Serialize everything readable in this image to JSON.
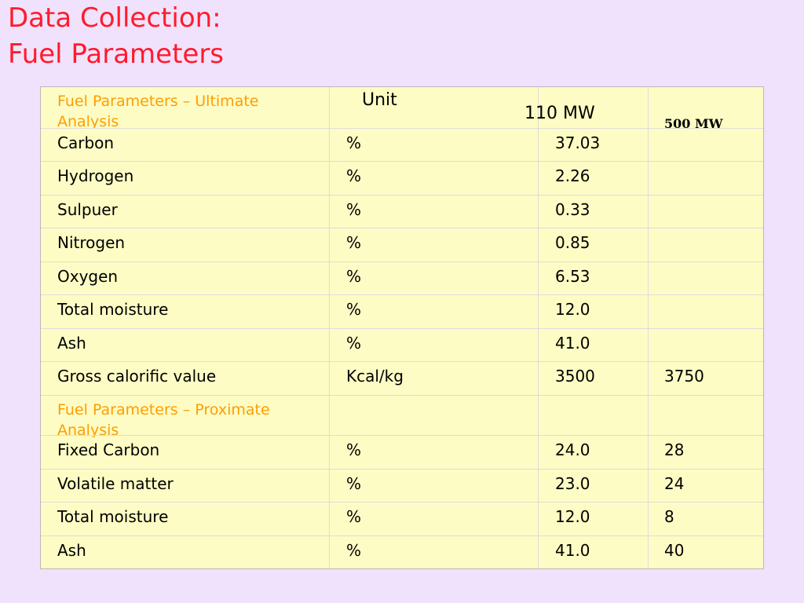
{
  "title": {
    "line1": "Data Collection:",
    "line2": "Fuel Parameters"
  },
  "table": {
    "header": {
      "section": "Fuel Parameters – Ultimate Analysis",
      "unit": "Unit",
      "col_110": "110 MW",
      "col_500": "500 MW"
    },
    "ultimate_rows": [
      {
        "name": "Carbon",
        "unit": "%",
        "v110": "37.03",
        "v500": ""
      },
      {
        "name": "Hydrogen",
        "unit": "%",
        "v110": "2.26",
        "v500": ""
      },
      {
        "name": "Sulpuer",
        "unit": "%",
        "v110": "0.33",
        "v500": ""
      },
      {
        "name": "Nitrogen",
        "unit": "%",
        "v110": "0.85",
        "v500": ""
      },
      {
        "name": "Oxygen",
        "unit": "%",
        "v110": "6.53",
        "v500": ""
      },
      {
        "name": "Total moisture",
        "unit": "%",
        "v110": "12.0",
        "v500": ""
      },
      {
        "name": "Ash",
        "unit": "%",
        "v110": "41.0",
        "v500": ""
      },
      {
        "name": "Gross calorific value",
        "unit": "Kcal/kg",
        "v110": "3500",
        "v500": "3750"
      }
    ],
    "proximate_section": "Fuel Parameters – Proximate Analysis",
    "proximate_rows": [
      {
        "name": "Fixed Carbon",
        "unit": "%",
        "v110": "24.0",
        "v500": "28"
      },
      {
        "name": "Volatile matter",
        "unit": "%",
        "v110": "23.0",
        "v500": "24"
      },
      {
        "name": "Total moisture",
        "unit": "%",
        "v110": "12.0",
        "v500": "8"
      },
      {
        "name": "Ash",
        "unit": "%",
        "v110": "41.0",
        "v500": "40"
      }
    ]
  },
  "colors": {
    "background": "#f0e2fc",
    "title": "#ff1b2c",
    "table_fill": "#fdfcc4",
    "section_header": "#ff9d00"
  }
}
